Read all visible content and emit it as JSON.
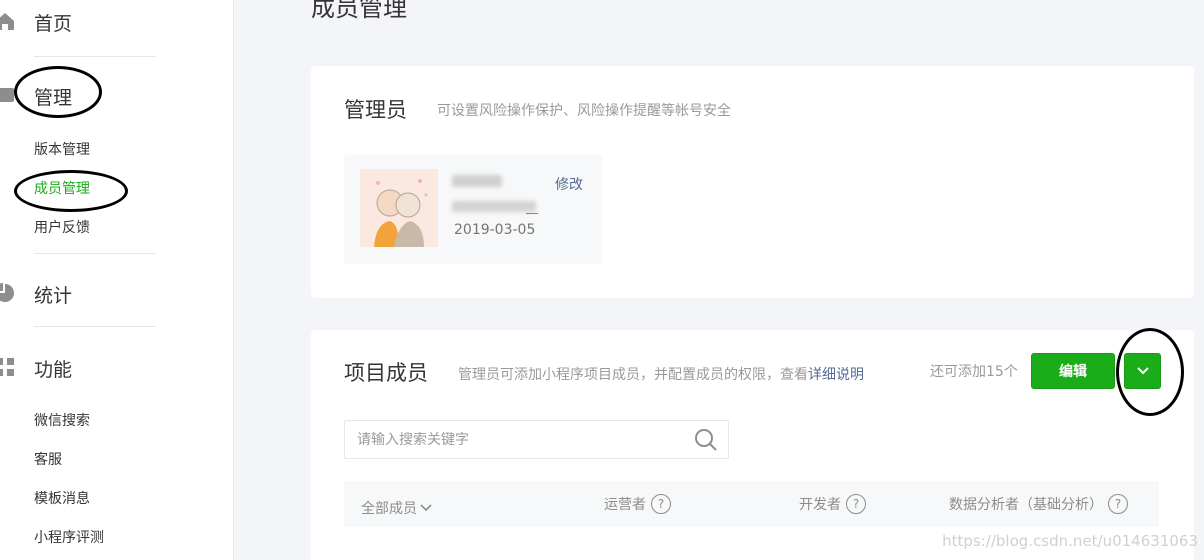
{
  "sidebar": {
    "home": {
      "label": "首页",
      "icon": "home-icon"
    },
    "manage": {
      "label": "管理",
      "icon": "manage-icon",
      "items": [
        {
          "label": "版本管理"
        },
        {
          "label": "成员管理",
          "active": true
        },
        {
          "label": "用户反馈"
        }
      ]
    },
    "stats": {
      "label": "统计",
      "icon": "pie-chart-icon"
    },
    "features": {
      "label": "功能",
      "icon": "grid-icon",
      "items": [
        {
          "label": "微信搜索"
        },
        {
          "label": "客服"
        },
        {
          "label": "模板消息"
        },
        {
          "label": "小程序评测"
        }
      ]
    }
  },
  "main": {
    "page_title": "成员管理",
    "admin_section": {
      "title": "管理员",
      "desc": "可设置风险操作保护、风险操作提醒等帐号安全",
      "modify_label": "修改",
      "date": "2019-03-05"
    },
    "members_section": {
      "title": "项目成员",
      "desc_prefix": "管理员可添加小程序项目成员，并配置成员的权限，查看",
      "desc_link": "详细说明",
      "remain": "还可添加15个",
      "edit_label": "编辑",
      "search_placeholder": "请输入搜索关键字",
      "columns": {
        "all": "全部成员",
        "operator": "运营者",
        "developer": "开发者",
        "analyst": "数据分析者（基础分析）"
      }
    }
  },
  "watermark": "https://blog.csdn.net/u014631063",
  "colors": {
    "accent": "#1aad19",
    "link": "#576b95"
  }
}
